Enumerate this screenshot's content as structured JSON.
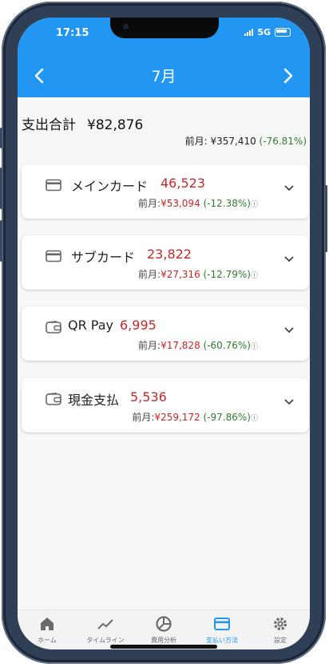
{
  "status_bar": {
    "time": "17:15",
    "network": "5G"
  },
  "header": {
    "title": "7月",
    "prev_label": "<",
    "next_label": ">"
  },
  "summary": {
    "label": "支出合計",
    "total": "¥82,876",
    "prev_label": "前月:",
    "prev_amount": "¥357,410",
    "prev_change": "(-76.81%)"
  },
  "methods": [
    {
      "name": "メインカード",
      "amount": "46,523",
      "icon": "credit-card-icon",
      "prev_label": "前月:",
      "prev_amount": "¥53,094",
      "change": "(-12.38%)"
    },
    {
      "name": "サブカード",
      "amount": "23,822",
      "icon": "credit-card-icon",
      "prev_label": "前月:",
      "prev_amount": "¥27,316",
      "change": "(-12.79%)"
    },
    {
      "name": "QR Pay",
      "amount": "6,995",
      "icon": "wallet-icon",
      "prev_label": "前月:",
      "prev_amount": "¥17,828",
      "change": "(-60.76%)"
    },
    {
      "name": "現金支払",
      "amount": "5,536",
      "icon": "wallet-icon",
      "prev_label": "前月:",
      "prev_amount": "¥259,172",
      "change": "(-97.86%)"
    }
  ],
  "tabs": [
    {
      "label": "ホーム",
      "icon": "home-icon"
    },
    {
      "label": "タイムライン",
      "icon": "trend-line-icon"
    },
    {
      "label": "費用分析",
      "icon": "pie-chart-icon"
    },
    {
      "label": "支払い方法",
      "icon": "credit-card-icon",
      "active": true
    },
    {
      "label": "設定",
      "icon": "gear-icon"
    }
  ],
  "colors": {
    "primary": "#2196f3",
    "negative_amount": "#c62828",
    "positive_change": "#2e7d32"
  }
}
